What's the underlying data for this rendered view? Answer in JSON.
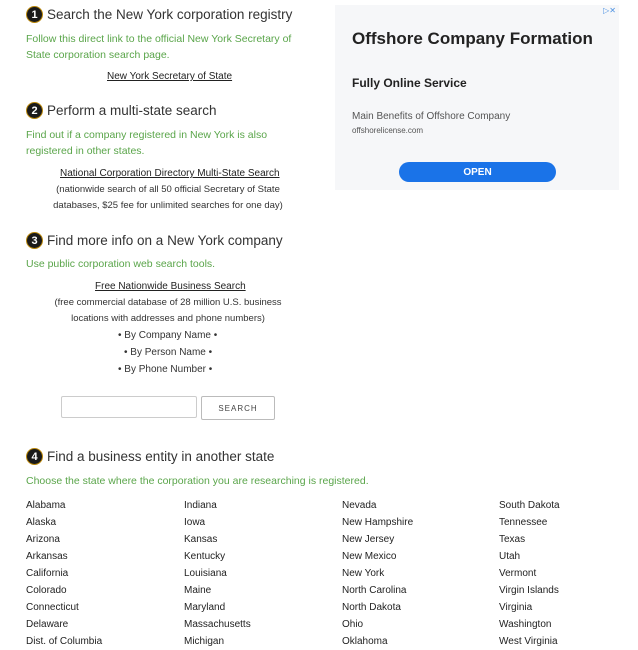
{
  "step1": {
    "number": "1",
    "title": "Search the New York corporation registry",
    "desc_line1": "Follow this direct link to the official New York Secretary of",
    "desc_line2": "State corporation search page.",
    "link": "New York Secretary of State"
  },
  "step2": {
    "number": "2",
    "title": "Perform a multi-state search",
    "desc_line1": "Find out if a company registered in New York is also",
    "desc_line2": "registered in other states.",
    "link": "National Corporation Directory Multi-State Search",
    "note_line1": "(nationwide search of all 50 official Secretary of State",
    "note_line2": "databases, $25 fee for unlimited searches for one day)"
  },
  "step3": {
    "number": "3",
    "title": "Find more info on a New York company",
    "desc": "Use public corporation web search tools.",
    "link": "Free Nationwide Business Search",
    "note_line1": "(free commercial database of 28 million U.S. business",
    "note_line2": "locations with addresses and phone numbers)",
    "by_company": "• By Company Name •",
    "by_person": "• By Person Name •",
    "by_phone": "• By Phone Number •",
    "search_value": "",
    "search_button": "SEARCH"
  },
  "step4": {
    "number": "4",
    "title": "Find a business entity in another state",
    "desc": "Choose the state where the corporation you are researching is registered.",
    "columns": [
      [
        "Alabama",
        "Alaska",
        "Arizona",
        "Arkansas",
        "California",
        "Colorado",
        "Connecticut",
        "Delaware",
        "Dist. of Columbia"
      ],
      [
        "Indiana",
        "Iowa",
        "Kansas",
        "Kentucky",
        "Louisiana",
        "Maine",
        "Maryland",
        "Massachusetts",
        "Michigan"
      ],
      [
        "Nevada",
        "New Hampshire",
        "New Jersey",
        "New Mexico",
        "New York",
        "North Carolina",
        "North Dakota",
        "Ohio",
        "Oklahoma"
      ],
      [
        "South Dakota",
        "Tennessee",
        "Texas",
        "Utah",
        "Vermont",
        "Virgin Islands",
        "Virginia",
        "Washington",
        "West Virginia"
      ]
    ]
  },
  "ad": {
    "marks": "▷✕",
    "title": "Offshore Company Formation",
    "subtitle": "Fully Online Service",
    "benefit": "Main Benefits of Offshore Company",
    "url": "offshorelicense.com",
    "button": "OPEN",
    "button_color": "#1a73e8"
  },
  "colors": {
    "green": "#5aa54a",
    "accent": "#1a73e8"
  }
}
